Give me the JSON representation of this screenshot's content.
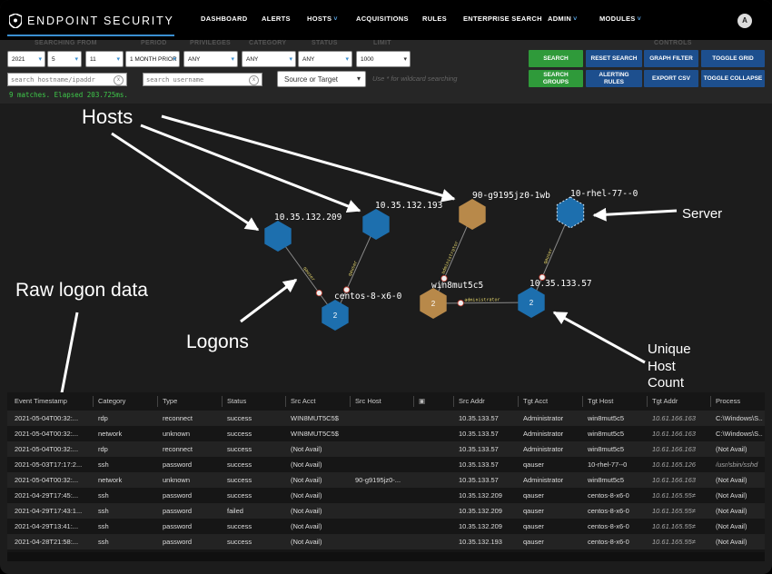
{
  "app": {
    "brand": "ENDPOINT SECURITY",
    "avatar_letter": "A",
    "accent": "#3a8fd1"
  },
  "nav": [
    {
      "label": "DASHBOARD",
      "dropdown": false
    },
    {
      "label": "ALERTS",
      "dropdown": false
    },
    {
      "label": "HOSTS",
      "dropdown": true
    },
    {
      "label": "ACQUISITIONS",
      "dropdown": false
    },
    {
      "label": "RULES",
      "dropdown": false
    },
    {
      "label": "ENTERPRISE SEARCH",
      "dropdown": false
    },
    {
      "label": "ADMIN",
      "dropdown": true
    },
    {
      "label": "MODULES",
      "dropdown": true
    }
  ],
  "filters": {
    "labels": {
      "searching_from": "SEARCHING FROM",
      "period": "PERIOD",
      "privileges": "PRIVILEGES",
      "category": "CATEGORY",
      "status": "STATUS",
      "limit": "LIMIT",
      "controls": "CONTROLS"
    },
    "year": "2021",
    "month": "5",
    "day": "11",
    "period": "1 MONTH PRIOR",
    "privileges": "ANY",
    "category": "ANY",
    "status": "ANY",
    "limit": "1000",
    "hostname_placeholder": "search hostname/ipaddr",
    "username_placeholder": "search username",
    "source_target": "Source or Target",
    "hint": "Use * for wildcard searching"
  },
  "buttons": {
    "search": "SEARCH",
    "search_groups": "SEARCH GROUPS",
    "reset_search": "RESET SEARCH",
    "alerting_rules": "ALERTING RULES",
    "graph_filter": "GRAPH FILTER",
    "export_csv": "EXPORT CSV",
    "toggle_grid": "TOGGLE GRID",
    "toggle_collapse": "TOGGLE COLLAPSE"
  },
  "status_line": "9 matches. Elapsed 203.725ms.",
  "colors": {
    "host_blue": "#1d6fae",
    "host_tan": "#b8894a",
    "edge": "#8a8a8a",
    "edge_label": "#e2d36a",
    "status_green": "#3ec94a"
  },
  "graph": {
    "nodes": [
      {
        "id": "n1",
        "label": "10.35.132.209",
        "color": "blue",
        "count": ""
      },
      {
        "id": "n2",
        "label": "10.35.132.193",
        "color": "blue",
        "count": ""
      },
      {
        "id": "n3",
        "label": "90-g9195jz0-1wb",
        "color": "tan",
        "count": ""
      },
      {
        "id": "n4",
        "label": "10-rhel-77--0",
        "color": "blue",
        "count": "",
        "dashed": true
      },
      {
        "id": "n5",
        "label": "centos-8-x6-0",
        "color": "blue",
        "count": "2"
      },
      {
        "id": "n6",
        "label": "win8mut5c5",
        "color": "tan",
        "count": "2"
      },
      {
        "id": "n7",
        "label": "10.35.133.57",
        "color": "blue",
        "count": "2"
      }
    ],
    "edges": [
      {
        "from": "n1",
        "to": "n5",
        "label": "qauser"
      },
      {
        "from": "n2",
        "to": "n5",
        "label": "qauser"
      },
      {
        "from": "n3",
        "to": "n6",
        "label": "administrator"
      },
      {
        "from": "n7",
        "to": "n6",
        "label": "administrator"
      },
      {
        "from": "n4",
        "to": "n7",
        "label": "qauser"
      }
    ],
    "annotations": {
      "hosts": "Hosts",
      "server": "Server",
      "logons": "Logons",
      "raw": "Raw logon data",
      "unique": [
        "Unique",
        "Host",
        "Count"
      ]
    }
  },
  "table": {
    "columns": [
      "Event Timestamp",
      "Category",
      "Type",
      "Status",
      "Src Acct",
      "Src Host",
      "",
      "Src Addr",
      "Tgt Acct",
      "Tgt Host",
      "Tgt Addr",
      "Process"
    ],
    "rows": [
      [
        "2021-05-04T00:32:...",
        "rdp",
        "reconnect",
        "success",
        "WIN8MUT5C5$",
        "",
        "",
        "10.35.133.57",
        "Administrator",
        "win8mut5c5",
        "10.61.166.163",
        "C:\\Windows\\S..."
      ],
      [
        "2021-05-04T00:32:...",
        "network",
        "unknown",
        "success",
        "WIN8MUT5C5$",
        "",
        "",
        "10.35.133.57",
        "Administrator",
        "win8mut5c5",
        "10.61.166.163",
        "C:\\Windows\\S..."
      ],
      [
        "2021-05-04T00:32:...",
        "rdp",
        "reconnect",
        "success",
        "(Not Avail)",
        "",
        "",
        "10.35.133.57",
        "Administrator",
        "win8mut5c5",
        "10.61.166.163",
        "(Not Avail)"
      ],
      [
        "2021-05-03T17:17:2...",
        "ssh",
        "password",
        "success",
        "(Not Avail)",
        "",
        "",
        "10.35.133.57",
        "qauser",
        "10-rhel-77--0",
        "10.61.165.126",
        "/usr/sbin/sshd"
      ],
      [
        "2021-05-04T00:32:...",
        "network",
        "unknown",
        "success",
        "(Not Avail)",
        "90-g9195jz0-...",
        "",
        "10.35.133.57",
        "Administrator",
        "win8mut5c5",
        "10.61.166.163",
        "(Not Avail)"
      ],
      [
        "2021-04-29T17:45:...",
        "ssh",
        "password",
        "success",
        "(Not Avail)",
        "",
        "",
        "10.35.132.209",
        "qauser",
        "centos-8-x6-0",
        "10.61.165.55≠",
        "(Not Avail)"
      ],
      [
        "2021-04-29T17:43:1...",
        "ssh",
        "password",
        "failed",
        "(Not Avail)",
        "",
        "",
        "10.35.132.209",
        "qauser",
        "centos-8-x6-0",
        "10.61.165.55≠",
        "(Not Avail)"
      ],
      [
        "2021-04-29T13:41:...",
        "ssh",
        "password",
        "success",
        "(Not Avail)",
        "",
        "",
        "10.35.132.209",
        "qauser",
        "centos-8-x6-0",
        "10.61.165.55≠",
        "(Not Avail)"
      ],
      [
        "2021-04-28T21:58:...",
        "ssh",
        "password",
        "success",
        "(Not Avail)",
        "",
        "",
        "10.35.132.193",
        "qauser",
        "centos-8-x6-0",
        "10.61.165.55≠",
        "(Not Avail)"
      ]
    ]
  }
}
